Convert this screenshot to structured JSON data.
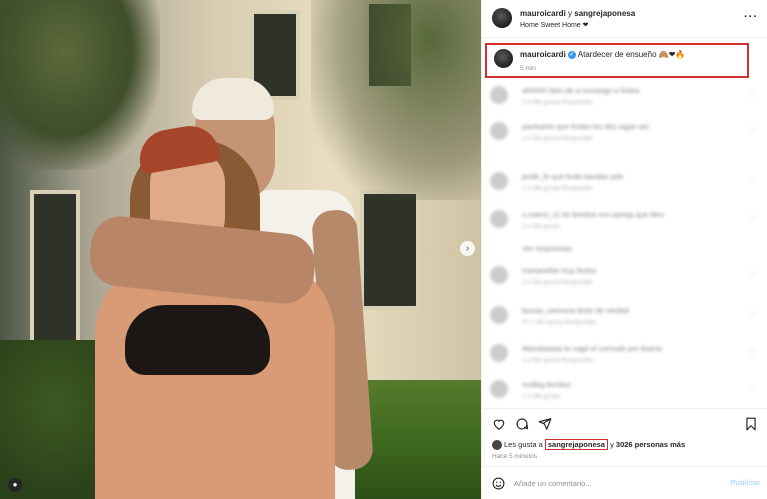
{
  "post": {
    "header": {
      "user1": "mauroicardi",
      "joiner": " y ",
      "user2": "sangrejaponesa",
      "location": "Home Sweet Home ❤"
    },
    "caption": {
      "username": "mauroicardi",
      "text": "Atardecer de ensueño 🙈❤🔥",
      "time": "5 min"
    },
    "comments": [
      {
        "text": "ahhhhh bien de a noviazgo a lindos",
        "meta": "2 d  Me gusta  Responder"
      },
      {
        "text": "paulsanto que lindos los dos sigan así",
        "meta": "2 d  Me gusta  Responder"
      },
      {
        "text": "profe_fe qué lindo bandao jefe",
        "meta": "2 d  Me gusta  Responder"
      },
      {
        "text": "s.noemi_11 ke bonitos son pareja que dios",
        "meta": "2 d  Me gusta"
      },
      {
        "text": "Ver respuestas",
        "meta": ""
      },
      {
        "text": "marianelita muy lindos",
        "meta": "1 d  Me gusta  Responder"
      },
      {
        "text": "lauraa_vannesa lindo de verdad",
        "meta": "47 s  Me gusta  Responder"
      },
      {
        "text": "Wandaaaaa te cagó el cornudo por buena",
        "meta": "1 d  Me gusta  Responder"
      },
      {
        "text": "roulbig bonitos",
        "meta": "1 d  Me gusta"
      }
    ],
    "likes": {
      "prefix": "Les gusta a ",
      "tagged": "sangrejaponesa",
      "middle": " y ",
      "count": "3026 personas más"
    },
    "ago": "Hace 5 minutos",
    "add_comment": {
      "placeholder": "Añade un comentario...",
      "publish": "Publicar"
    }
  },
  "icons": {
    "more": "more-dots-icon",
    "like": "heart-icon",
    "comment": "comment-icon",
    "share": "send-icon",
    "save": "bookmark-icon",
    "emoji": "smile-icon",
    "next": "chevron-right-icon",
    "user_tag": "user-icon"
  },
  "colors": {
    "highlight": "#d32f2f",
    "verified": "#3897f0",
    "publish": "#b3dbff"
  }
}
